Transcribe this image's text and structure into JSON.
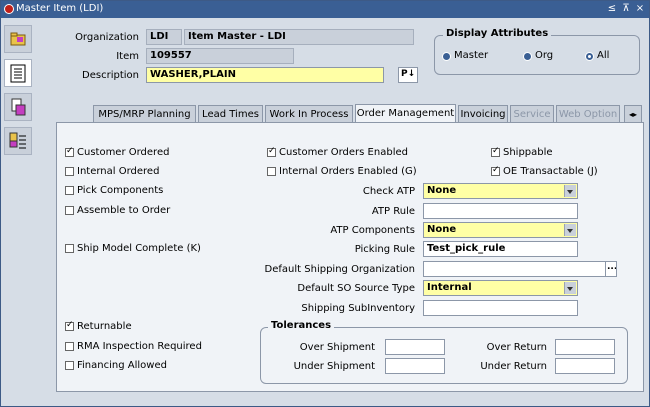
{
  "window": {
    "title": "Master Item (LDI)",
    "controls": [
      "≤",
      "⊼",
      "×"
    ]
  },
  "header": {
    "organization_label": "Organization",
    "organization_code": "LDI",
    "organization_name": "Item Master - LDI",
    "item_label": "Item",
    "item_value": "109557",
    "description_label": "Description",
    "description_value": "WASHER,PLAIN",
    "edit_button": "P↓"
  },
  "display_attributes": {
    "title": "Display Attributes",
    "options": [
      "Master",
      "Org",
      "All"
    ],
    "selected": "All"
  },
  "left_toolbar": {
    "icons": [
      "folder-icon",
      "list-icon",
      "database-icon",
      "list-color-icon"
    ]
  },
  "tabs": [
    {
      "label": "MPS/MRP Planning",
      "state": "normal"
    },
    {
      "label": "Lead Times",
      "state": "normal"
    },
    {
      "label": "Work In Process",
      "state": "normal"
    },
    {
      "label": "Order Management",
      "state": "selected"
    },
    {
      "label": "Invoicing",
      "state": "normal"
    },
    {
      "label": "Service",
      "state": "disabled"
    },
    {
      "label": "Web Option",
      "state": "disabled"
    }
  ],
  "tab_scroll": "◂▸",
  "checkboxes": {
    "customer_ordered": {
      "label": "Customer Ordered",
      "checked": true
    },
    "internal_ordered": {
      "label": "Internal Ordered",
      "checked": false
    },
    "pick_components": {
      "label": "Pick Components",
      "checked": false
    },
    "assemble_to_order": {
      "label": "Assemble to Order",
      "checked": false
    },
    "ship_model_complete": {
      "label": "Ship Model Complete (K)",
      "checked": false
    },
    "customer_orders_enabled": {
      "label": "Customer Orders Enabled",
      "checked": true
    },
    "internal_orders_enabled": {
      "label": "Internal Orders Enabled (G)",
      "checked": false
    },
    "shippable": {
      "label": "Shippable",
      "checked": true
    },
    "oe_transactable": {
      "label": "OE Transactable (J)",
      "checked": true
    },
    "returnable": {
      "label": "Returnable",
      "checked": true
    },
    "rma_inspection_required": {
      "label": "RMA Inspection Required",
      "checked": false
    },
    "financing_allowed": {
      "label": "Financing Allowed",
      "checked": false
    }
  },
  "fields": {
    "check_atp": {
      "label": "Check ATP",
      "value": "None"
    },
    "atp_rule": {
      "label": "ATP Rule",
      "value": ""
    },
    "atp_components": {
      "label": "ATP Components",
      "value": "None"
    },
    "picking_rule": {
      "label": "Picking Rule",
      "value": "Test_pick_rule"
    },
    "default_shipping_org": {
      "label": "Default Shipping Organization",
      "value": ""
    },
    "default_so_source_type": {
      "label": "Default SO Source Type",
      "value": "Internal"
    },
    "shipping_subinventory": {
      "label": "Shipping SubInventory",
      "value": ""
    },
    "lov_button": "..."
  },
  "tolerances": {
    "title": "Tolerances",
    "over_shipment": {
      "label": "Over Shipment",
      "value": ""
    },
    "under_shipment": {
      "label": "Under Shipment",
      "value": ""
    },
    "over_return": {
      "label": "Over Return",
      "value": ""
    },
    "under_return": {
      "label": "Under Return",
      "value": ""
    }
  }
}
